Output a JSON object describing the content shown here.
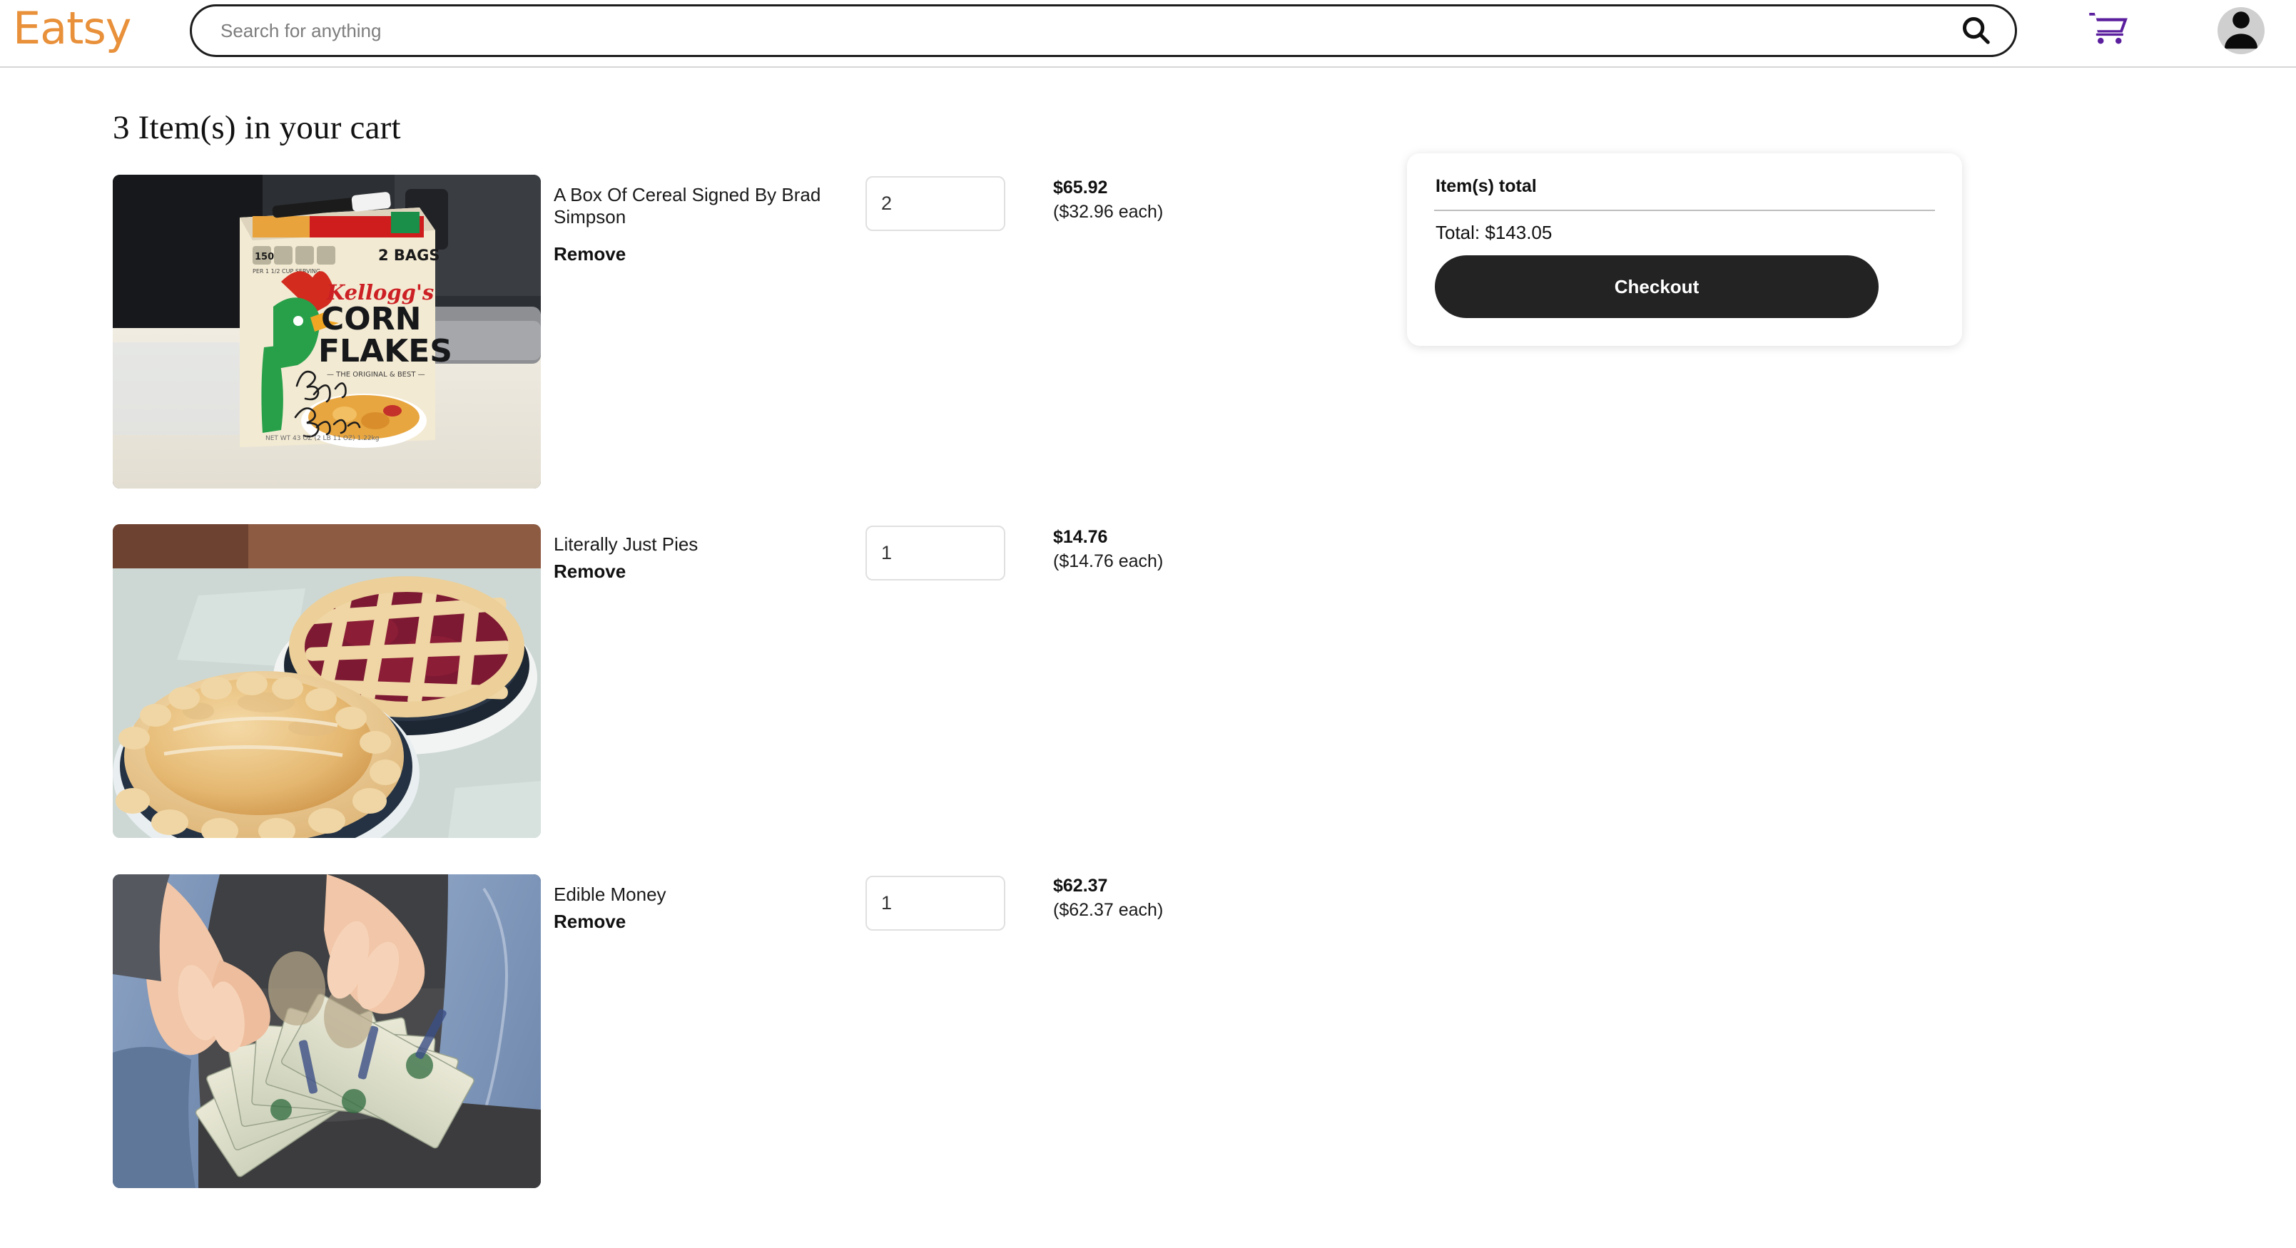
{
  "header": {
    "logo_text": "Eatsy",
    "logo_color": "#e8903a",
    "search": {
      "placeholder": "Search for anything",
      "value": "",
      "icon": "search-icon"
    },
    "cart_icon": "shopping-cart-icon",
    "cart_icon_color": "#5b1f9e",
    "account_icon": "user-avatar-icon"
  },
  "page": {
    "title": "3 Item(s) in your cart"
  },
  "cart": {
    "items": [
      {
        "title": "A Box Of Cereal Signed By Brad Simpson",
        "remove_label": "Remove",
        "quantity": "2",
        "line_total": "$65.92",
        "unit_price": "($32.96 each)",
        "image_alt": "kelloggs-corn-flakes-box-signed"
      },
      {
        "title": "Literally Just Pies",
        "remove_label": "Remove",
        "quantity": "1",
        "line_total": "$14.76",
        "unit_price": "($14.76 each)",
        "image_alt": "two-baked-pies-lattice-cherry"
      },
      {
        "title": "Edible Money",
        "remove_label": "Remove",
        "quantity": "1",
        "line_total": "$62.37",
        "unit_price": "($62.37 each)",
        "image_alt": "hands-holding-fanned-hundred-dollar-bills"
      }
    ]
  },
  "summary": {
    "heading": "Item(s) total",
    "total_label": "Total: $143.05",
    "checkout_label": "Checkout",
    "button_color": "#232323"
  }
}
